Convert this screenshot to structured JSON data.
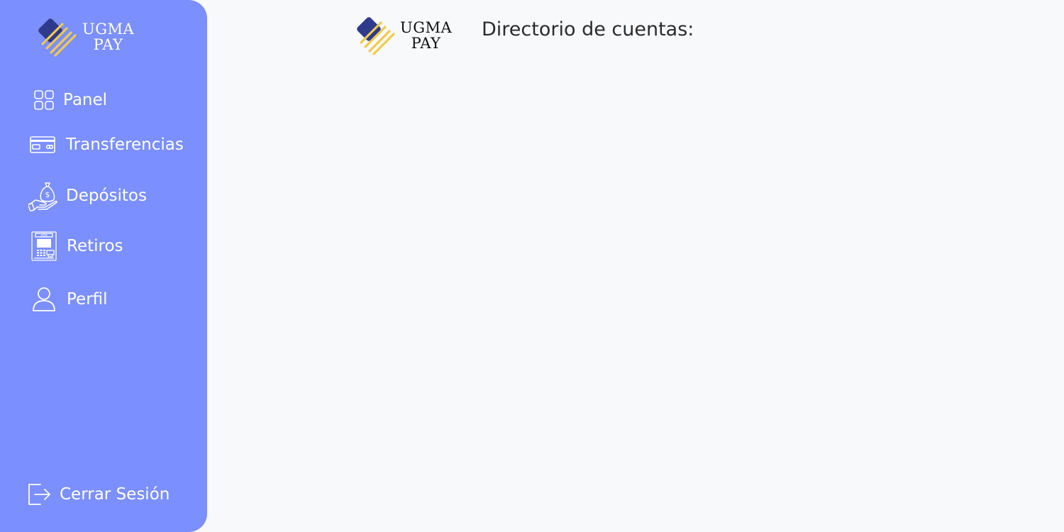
{
  "brand": {
    "line1": "UGMA",
    "line2": "PAY"
  },
  "sidebar": {
    "items": [
      {
        "label": "Panel",
        "icon": "grid-icon"
      },
      {
        "label": "Transferencias",
        "icon": "credit-card-icon"
      },
      {
        "label": "Depósitos",
        "icon": "money-bag-hand-icon"
      },
      {
        "label": "Retiros",
        "icon": "atm-icon"
      },
      {
        "label": "Perfil",
        "icon": "user-icon"
      }
    ],
    "logout": {
      "label": "Cerrar Sesión",
      "icon": "logout-icon"
    }
  },
  "main": {
    "title": "Directorio de cuentas:"
  },
  "colors": {
    "sidebar_bg": "#7b8ffe",
    "page_bg": "#f8f9fb",
    "logo_navy": "#2e3a8c",
    "logo_yellow": "#f2c94c"
  }
}
